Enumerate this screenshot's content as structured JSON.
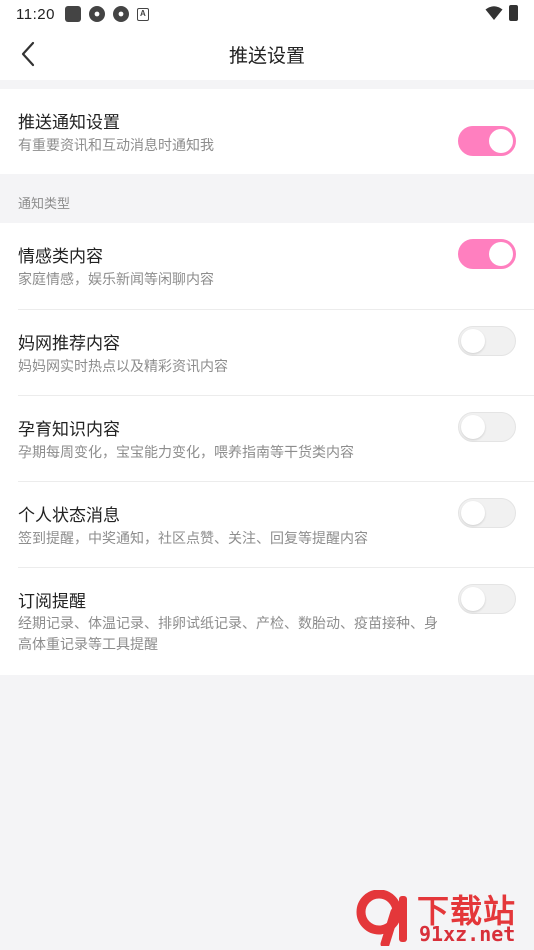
{
  "status_bar": {
    "time": "11:20",
    "a_icon_letter": "A"
  },
  "nav": {
    "title": "推送设置"
  },
  "push_main": {
    "title": "推送通知设置",
    "description": "有重要资讯和互动消息时通知我",
    "enabled": true
  },
  "group_label": "通知类型",
  "items": [
    {
      "title": "情感类内容",
      "description": "家庭情感，娱乐新闻等闲聊内容",
      "enabled": true
    },
    {
      "title": "妈网推荐内容",
      "description": "妈妈网实时热点以及精彩资讯内容",
      "enabled": false
    },
    {
      "title": "孕育知识内容",
      "description": "孕期每周变化，宝宝能力变化，喂养指南等干货类内容",
      "enabled": false
    },
    {
      "title": "个人状态消息",
      "description": "签到提醒，中奖通知，社区点赞、关注、回复等提醒内容",
      "enabled": false
    },
    {
      "title": "订阅提醒",
      "description": "经期记录、体温记录、排卵试纸记录、产检、数胎动、疫苗接种、身高体重记录等工具提醒",
      "enabled": false
    }
  ],
  "watermark": {
    "top": "下载站",
    "bottom": "91xz.net"
  },
  "colors": {
    "accent": "#ff7fbf",
    "background": "#f4f4f6",
    "watermark": "#e4373a"
  }
}
